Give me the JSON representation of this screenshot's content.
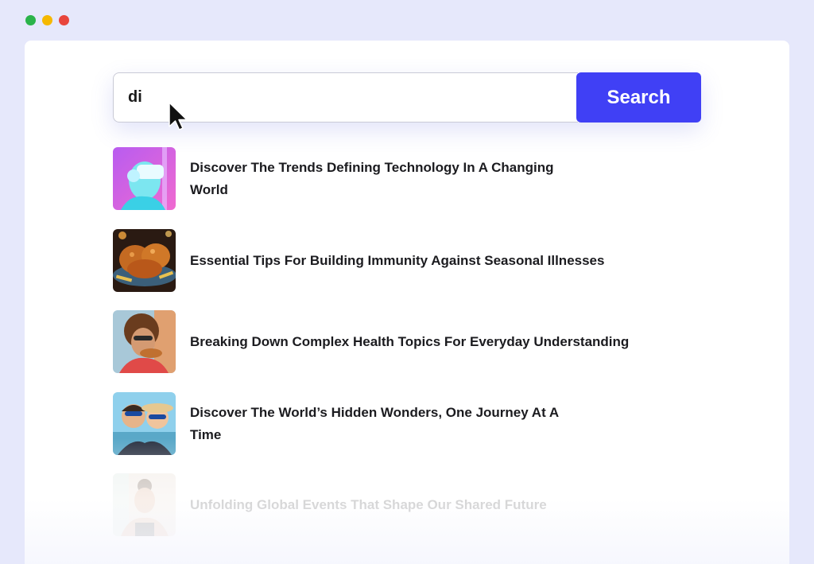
{
  "window_controls": {
    "colors": [
      "#2bb34a",
      "#f5b800",
      "#e8453c"
    ]
  },
  "search": {
    "value": "di",
    "button_label": "Search",
    "accent": "#4040f5"
  },
  "results": [
    {
      "title": "Discover The Trends Defining Technology In A Changing World",
      "thumbnail": "vr-headset-person-image"
    },
    {
      "title": "Essential Tips For Building Immunity Against Seasonal Illnesses",
      "thumbnail": "fried-chicken-image"
    },
    {
      "title": "Breaking Down Complex Health Topics For Everyday Understanding",
      "thumbnail": "person-eating-image"
    },
    {
      "title": "Discover The World’s Hidden Wonders, One Journey At A Time",
      "thumbnail": "couple-selfie-image"
    },
    {
      "title": "Unfolding Global Events That Shape Our Shared Future",
      "thumbnail": "woman-portrait-image"
    }
  ]
}
